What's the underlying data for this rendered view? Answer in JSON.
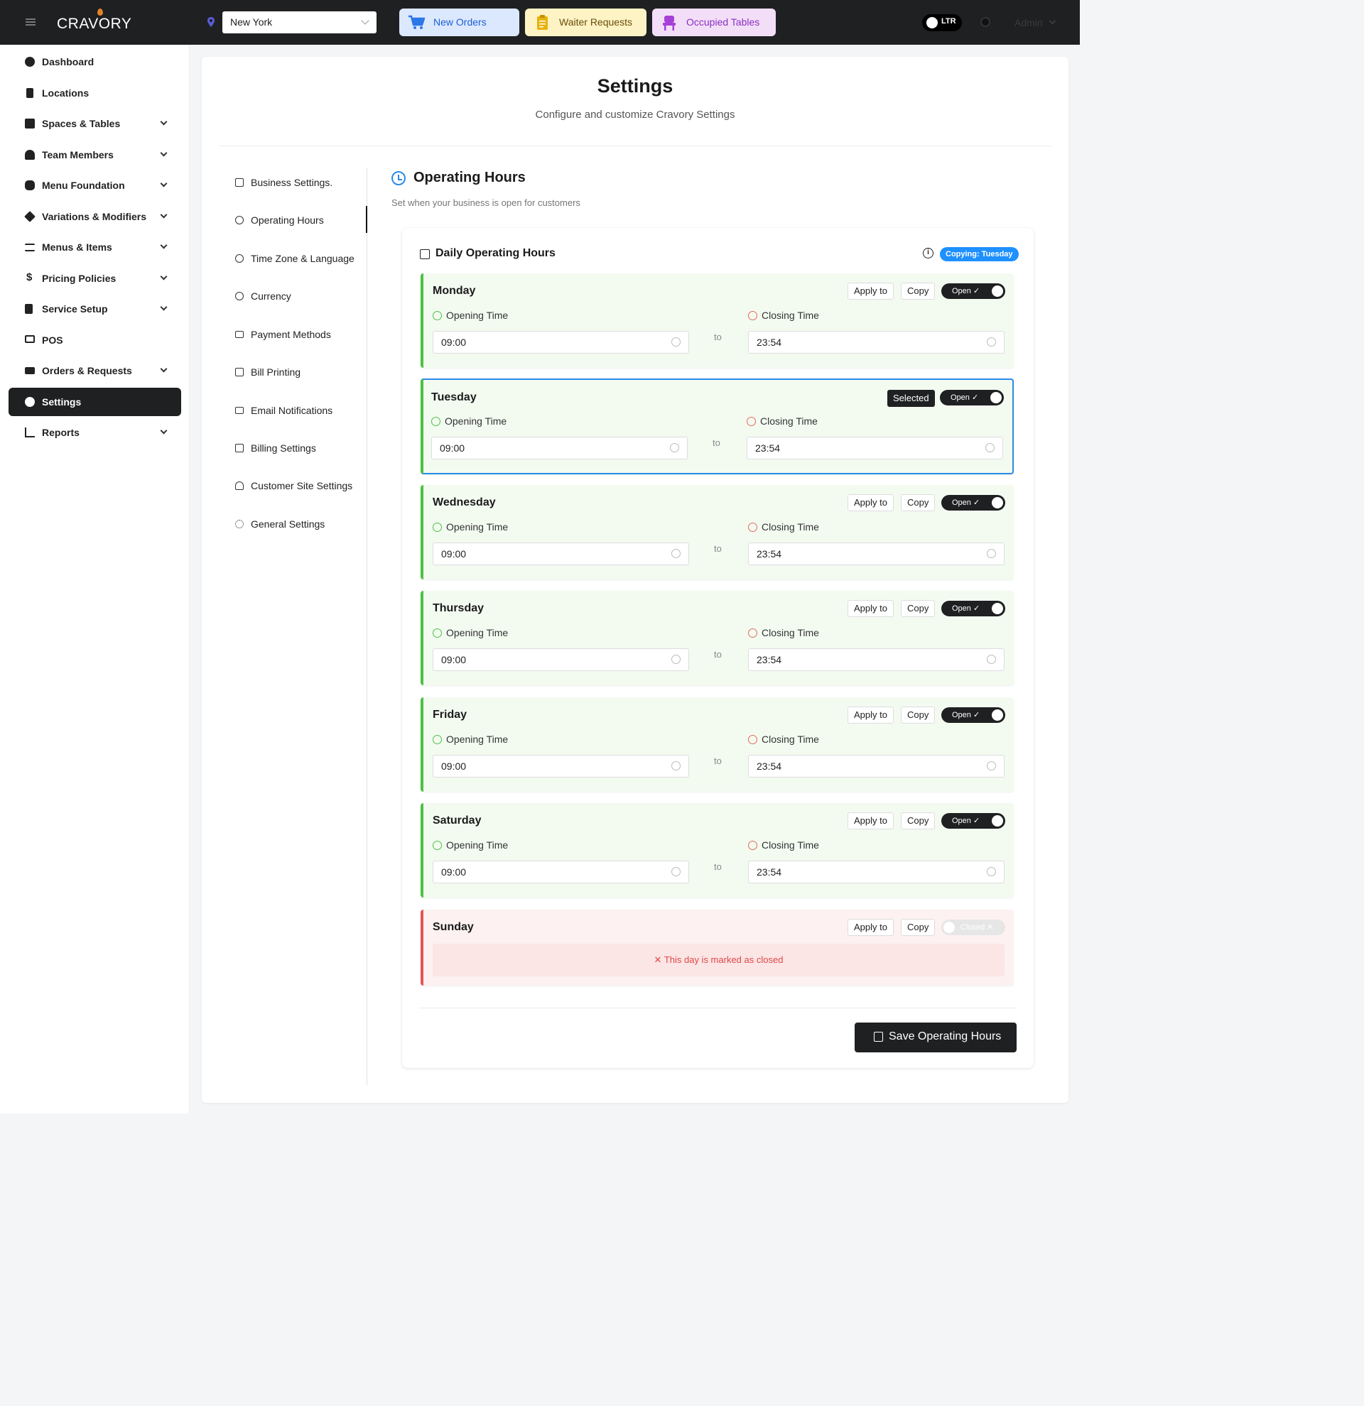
{
  "app": {
    "logo": "CRAVORY"
  },
  "header": {
    "location": "New York",
    "buttons": {
      "new_orders": "New Orders",
      "waiter_requests": "Waiter Requests",
      "occupied_tables": "Occupied Tables"
    },
    "direction": "LTR",
    "user": "Admin"
  },
  "sidebar": {
    "items": [
      {
        "label": "Dashboard",
        "icon": "dashboard-icon"
      },
      {
        "label": "Locations",
        "icon": "building-icon"
      },
      {
        "label": "Spaces & Tables",
        "icon": "grid-icon"
      },
      {
        "label": "Team Members",
        "icon": "users-icon"
      },
      {
        "label": "Menu Foundation",
        "icon": "database-icon"
      },
      {
        "label": "Variations & Modifiers",
        "icon": "layers-icon"
      },
      {
        "label": "Menus & Items",
        "icon": "list-icon"
      },
      {
        "label": "Pricing Policies",
        "icon": "dollar-icon"
      },
      {
        "label": "Service Setup",
        "icon": "utensils-icon"
      },
      {
        "label": "POS",
        "icon": "monitor-icon"
      },
      {
        "label": "Orders & Requests",
        "icon": "cart-icon"
      },
      {
        "label": "Settings",
        "icon": "gear-icon"
      },
      {
        "label": "Reports",
        "icon": "chart-icon"
      }
    ]
  },
  "page": {
    "title": "Settings",
    "subtitle": "Configure and customize Cravory Settings"
  },
  "settings_nav": {
    "items": [
      {
        "label": "Business Settings.",
        "icon": "store-icon"
      },
      {
        "label": "Operating Hours",
        "icon": "clock-icon"
      },
      {
        "label": "Time Zone & Language",
        "icon": "globe-icon"
      },
      {
        "label": "Currency",
        "icon": "currency-icon"
      },
      {
        "label": "Payment Methods",
        "icon": "card-icon"
      },
      {
        "label": "Bill Printing",
        "icon": "printer-icon"
      },
      {
        "label": "Email Notifications",
        "icon": "mail-icon"
      },
      {
        "label": "Billing Settings",
        "icon": "calculator-icon"
      },
      {
        "label": "Customer Site Settings",
        "icon": "user-icon"
      },
      {
        "label": "General Settings",
        "icon": "cog-icon"
      }
    ]
  },
  "operating_hours": {
    "title": "Operating Hours",
    "subtitle": "Set when your business is open for customers",
    "card_title": "Daily Operating Hours",
    "copying_badge": "Copying: Tuesday",
    "apply_label": "Apply to",
    "copy_label": "Copy",
    "selected_label": "Selected",
    "open_toggle": "Open ✓",
    "closed_toggle": "Closed ✕",
    "opening_label": "Opening Time",
    "closing_label": "Closing Time",
    "to_label": "to",
    "closed_message": "✕  This day is marked as closed",
    "save_label": "Save Operating Hours",
    "days": [
      {
        "name": "Monday",
        "open": "09:00",
        "close": "23:54"
      },
      {
        "name": "Tuesday",
        "open": "09:00",
        "close": "23:54"
      },
      {
        "name": "Wednesday",
        "open": "09:00",
        "close": "23:54"
      },
      {
        "name": "Thursday",
        "open": "09:00",
        "close": "23:54"
      },
      {
        "name": "Friday",
        "open": "09:00",
        "close": "23:54"
      },
      {
        "name": "Saturday",
        "open": "09:00",
        "close": "23:54"
      },
      {
        "name": "Sunday"
      }
    ]
  },
  "colors": {
    "dark": "#1f2022",
    "accent_blue": "#2b8ae6",
    "open_green": "#4cc142",
    "closed_red": "#e25555"
  }
}
